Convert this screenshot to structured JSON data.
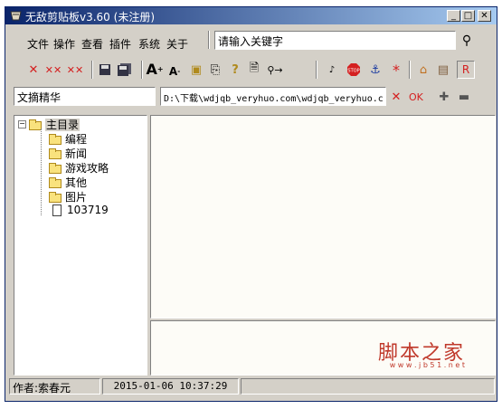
{
  "window": {
    "title": "无敌剪贴板v3.60 (未注册)"
  },
  "menu": [
    "文件",
    "操作",
    "查看",
    "插件",
    "系统",
    "关于"
  ],
  "search": {
    "placeholder": "请输入关键字"
  },
  "category_field": "文摘精华",
  "path_field": "D:\\下载\\wdjqb_veryhuo.com\\wdjqb_veryhuo.c",
  "ok_label": "OK",
  "tree": {
    "root": "主目录",
    "items": [
      "编程",
      "新闻",
      "游戏攻略",
      "其他",
      "图片"
    ],
    "file": "103719"
  },
  "status": {
    "author": "作者:索春元",
    "datetime": "2015-01-06 10:37:29"
  },
  "watermark": {
    "text": "脚本之家",
    "url": "w w w . j b 5 1 . n e t"
  },
  "colors": {
    "titlebar": "#0a246a",
    "watermark": "#c0392b",
    "accent_red": "#d42020"
  }
}
